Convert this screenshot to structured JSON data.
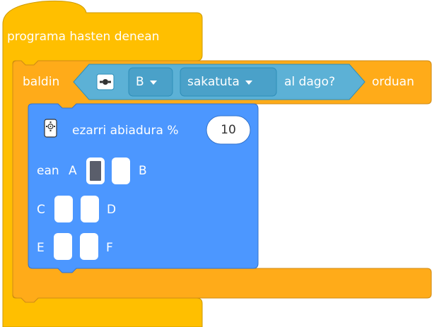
{
  "hat_block": {
    "label": "programa hasten denean",
    "color": "#ffbf00"
  },
  "if_block": {
    "label_if": "baldin",
    "label_then": "orduan",
    "color": "#ffab19",
    "condition": {
      "button_value": "B",
      "state_value": "sakatuta",
      "suffix": "al dago?",
      "icon": "controller-icon",
      "color": "#5cb1d6"
    }
  },
  "motor_block": {
    "label": "ezarri abiadura %",
    "speed_value": "10",
    "icon": "motor-icon",
    "color": "#4c97ff",
    "ports_label": "ean",
    "ports": [
      {
        "name": "A",
        "selected": true
      },
      {
        "name": "B",
        "selected": false
      },
      {
        "name": "C",
        "selected": false
      },
      {
        "name": "D",
        "selected": false
      },
      {
        "name": "E",
        "selected": false
      },
      {
        "name": "F",
        "selected": false
      }
    ]
  }
}
